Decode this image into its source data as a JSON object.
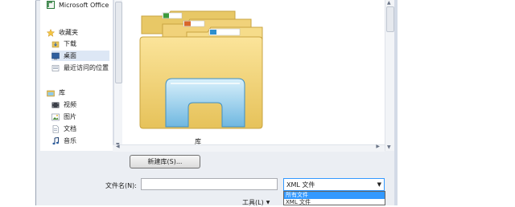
{
  "sidebar": {
    "top_item": {
      "label": "Microsoft Office",
      "icon": "office-icon"
    },
    "favorites": {
      "header": "收藏夹",
      "items": [
        {
          "label": "下载",
          "icon": "download-folder-icon"
        },
        {
          "label": "桌面",
          "icon": "desktop-icon"
        },
        {
          "label": "最近访问的位置",
          "icon": "recent-places-icon"
        }
      ]
    },
    "libraries": {
      "header": "库",
      "items": [
        {
          "label": "视频",
          "icon": "video-icon"
        },
        {
          "label": "图片",
          "icon": "picture-icon"
        },
        {
          "label": "文档",
          "icon": "document-icon"
        },
        {
          "label": "音乐",
          "icon": "music-icon"
        }
      ]
    }
  },
  "content": {
    "library_label": "库"
  },
  "buttons": {
    "new_library": "新建库(S)..."
  },
  "filename": {
    "label": "文件名(N):",
    "value": ""
  },
  "filetype": {
    "selected": "XML 文件",
    "options": [
      "所有文件",
      "XML 文件"
    ]
  },
  "tools": {
    "label": "工具(L)"
  },
  "colors": {
    "selection": "#3399ff",
    "nav_selected": "#dde7f5",
    "dialog_bg": "#ebeef3"
  }
}
